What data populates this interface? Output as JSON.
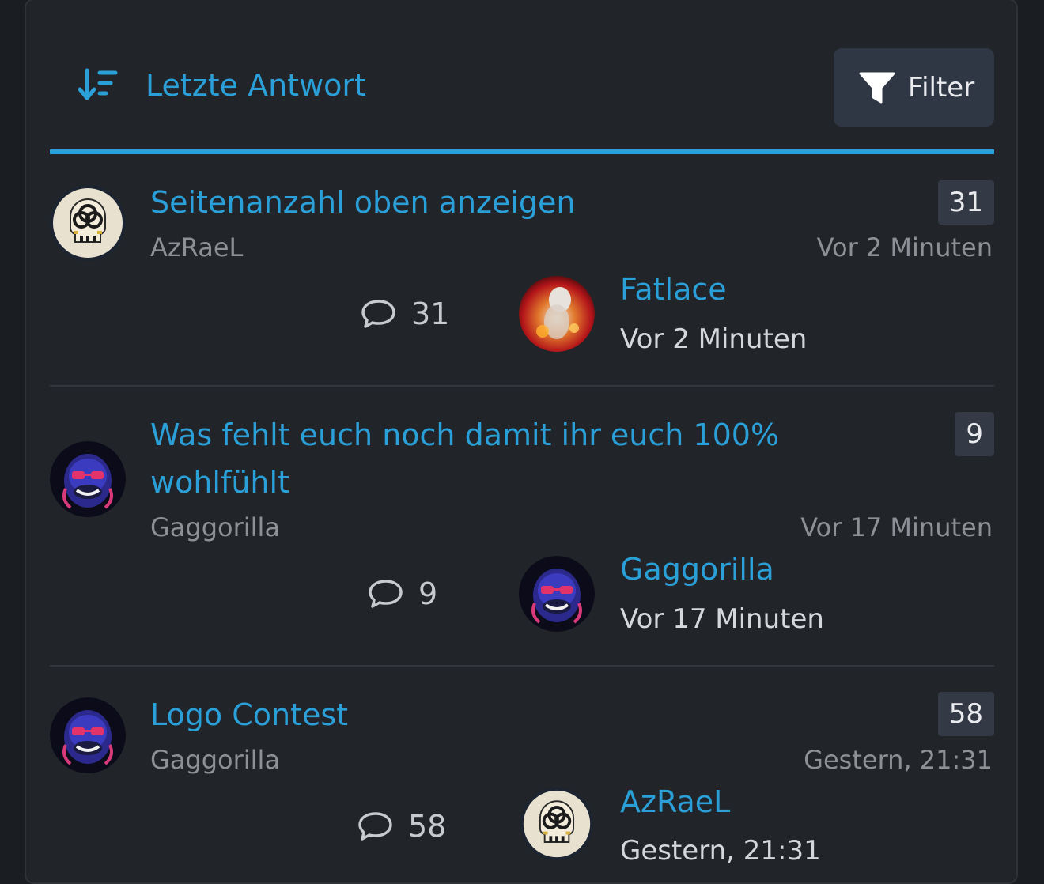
{
  "header": {
    "sort_label": "Letzte Antwort",
    "sort_icon": "sort-descending-icon",
    "filter_label": "Filter",
    "filter_icon": "funnel-icon"
  },
  "colors": {
    "accent": "#2a9fd8",
    "background": "#212428",
    "badge": "#343a45",
    "muted_text": "#8d9196"
  },
  "threads": [
    {
      "title": "Seitenanzahl oben anzeigen",
      "author": "AzRaeL",
      "author_avatar": "biohazard-skull-avatar",
      "badge": "31",
      "time": "Vor 2 Minuten",
      "replies": "31",
      "last_user": "Fatlace",
      "last_avatar": "fire-portrait-avatar",
      "last_time": "Vor 2 Minuten"
    },
    {
      "title": "Was fehlt euch noch damit ihr euch 100% wohlfühlt",
      "author": "Gaggorilla",
      "author_avatar": "gorilla-avatar",
      "badge": "9",
      "time": "Vor 17 Minuten",
      "replies": "9",
      "last_user": "Gaggorilla",
      "last_avatar": "gorilla-avatar",
      "last_time": "Vor 17 Minuten"
    },
    {
      "title": "Logo Contest",
      "author": "Gaggorilla",
      "author_avatar": "gorilla-avatar",
      "badge": "58",
      "time": "Gestern, 21:31",
      "replies": "58",
      "last_user": "AzRaeL",
      "last_avatar": "biohazard-skull-avatar",
      "last_time": "Gestern, 21:31"
    }
  ]
}
